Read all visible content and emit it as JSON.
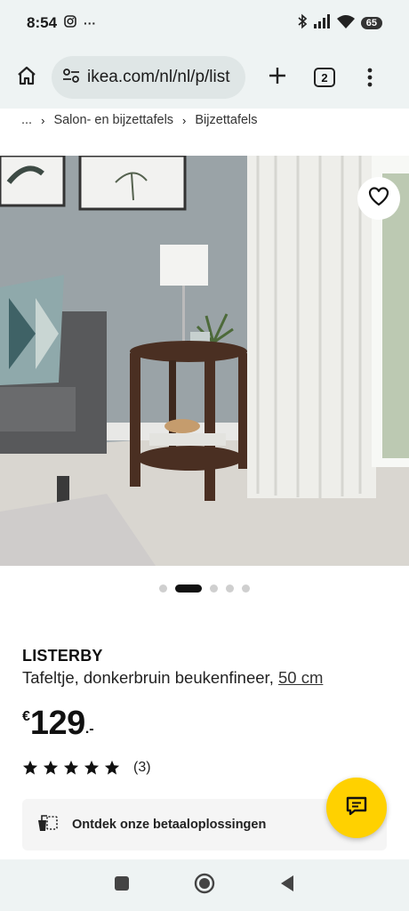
{
  "status_bar": {
    "time": "8:54",
    "more": "···",
    "battery": "65"
  },
  "browser": {
    "url": "ikea.com/nl/nl/p/list",
    "tab_count": "2"
  },
  "breadcrumb": {
    "ellipsis": "...",
    "items": [
      "Salon- en bijzettafels",
      "Bijzettafels"
    ]
  },
  "carousel": {
    "total": 5,
    "active_index": 1
  },
  "product": {
    "name": "LISTERBY",
    "description": "Tafeltje, donkerbruin beukenfineer, ",
    "size": "50 cm",
    "price": {
      "currency": "€",
      "amount": "129",
      "decimals": ".-"
    },
    "rating": {
      "stars": 5,
      "max": 5,
      "count": "(3)"
    }
  },
  "payment_banner": {
    "text": "Ontdek onze betaaloplossingen"
  },
  "colors": {
    "accent_yellow": "#ffd100",
    "toolbar_bg": "#eef3f3"
  },
  "icons": [
    "instagram-icon",
    "bluetooth-icon",
    "signal-icon",
    "wifi-icon",
    "home-icon",
    "site-settings-icon",
    "plus-icon",
    "tabs-icon",
    "kebab-menu-icon",
    "heart-icon",
    "star-icon",
    "payment-icon",
    "chat-icon",
    "nav-recents-icon",
    "nav-home-icon",
    "nav-back-icon"
  ]
}
